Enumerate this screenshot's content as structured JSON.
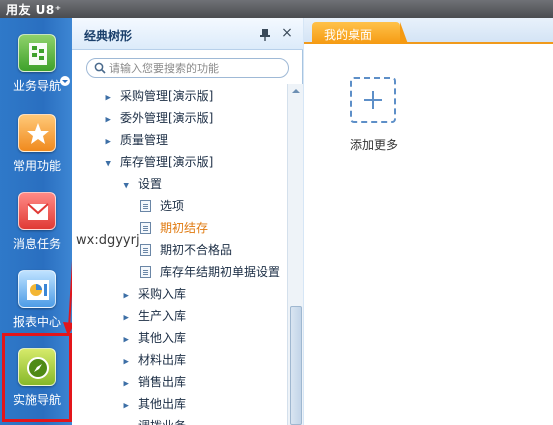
{
  "titlebar": {
    "brand": "用友 U8⁺"
  },
  "left_nav": {
    "items": [
      {
        "label": "业务导航",
        "icon": "business-nav-icon"
      },
      {
        "label": "常用功能",
        "icon": "star-icon"
      },
      {
        "label": "消息任务",
        "icon": "envelope-icon"
      },
      {
        "label": "报表中心",
        "icon": "pie-chart-icon"
      },
      {
        "label": "实施导航",
        "icon": "compass-icon"
      }
    ]
  },
  "tree_panel": {
    "title": "经典树形",
    "search_placeholder": "请输入您要搜索的功能",
    "rows": [
      {
        "label": "采购管理[演示版]",
        "type": "collapsed"
      },
      {
        "label": "委外管理[演示版]",
        "type": "collapsed"
      },
      {
        "label": "质量管理",
        "type": "collapsed"
      },
      {
        "label": "库存管理[演示版]",
        "type": "expanded"
      },
      {
        "label": "设置",
        "type": "expanded"
      },
      {
        "label": "选项",
        "type": "leaf"
      },
      {
        "label": "期初结存",
        "type": "leaf",
        "selected": true
      },
      {
        "label": "期初不合格品",
        "type": "leaf"
      },
      {
        "label": "库存年结期初单据设置",
        "type": "leaf"
      },
      {
        "label": "采购入库",
        "type": "collapsed"
      },
      {
        "label": "生产入库",
        "type": "collapsed"
      },
      {
        "label": "其他入库",
        "type": "collapsed"
      },
      {
        "label": "材料出库",
        "type": "collapsed"
      },
      {
        "label": "销售出库",
        "type": "collapsed"
      },
      {
        "label": "其他出库",
        "type": "collapsed"
      },
      {
        "label": "调拨业务",
        "type": "collapsed"
      }
    ]
  },
  "watermark": "wx:dgyyrj",
  "desktop": {
    "tab_label": "我的桌面",
    "add_more_label": "添加更多"
  },
  "colors": {
    "rail_blue": "#2a6fc0",
    "tab_orange": "#f59a12",
    "highlight_red": "#e3151a",
    "selected_text": "#e07a10"
  }
}
